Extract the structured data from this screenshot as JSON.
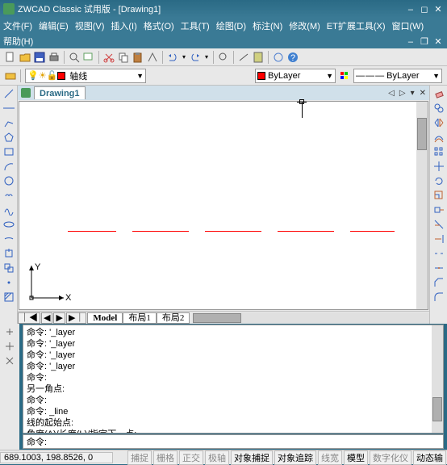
{
  "title": "ZWCAD Classic 试用版 - [Drawing1]",
  "menus": [
    "文件(F)",
    "编辑(E)",
    "视图(V)",
    "插入(I)",
    "格式(O)",
    "工具(T)",
    "绘图(D)",
    "标注(N)",
    "修改(M)",
    "ET扩展工具(X)",
    "窗口(W)"
  ],
  "help": "帮助(H)",
  "layer": {
    "name": "轴线"
  },
  "bylayer": "ByLayer",
  "doc_tab": "Drawing1",
  "layout_tabs": [
    "Model",
    "布局1",
    "布局2"
  ],
  "cmd_history": "命令: '_layer\n命令: '_layer\n命令: '_layer\n命令: '_layer\n命令:\n另一角点:\n命令:\n命令: _line\n线的起始点:\n角度(A)/长度(L)/指定下一点:\n角度(A)/长度(L)/跟踪(F)/撤消(U)/指定下一点:",
  "cmd_prompt": "命令:",
  "coords": "689.1003, 198.8526, 0",
  "status_buttons": [
    "捕捉",
    "栅格",
    "正交",
    "极轴",
    "对象捕捉",
    "对象追踪",
    "线宽",
    "模型",
    "数字化仪",
    "动态输"
  ],
  "status_on": [
    4,
    5,
    7,
    9
  ],
  "colors": {
    "red": "#ff0000"
  }
}
